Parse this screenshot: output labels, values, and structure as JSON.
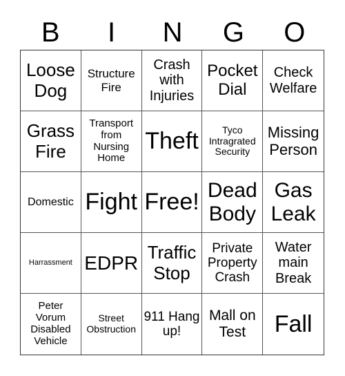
{
  "header": {
    "letters": [
      "B",
      "I",
      "N",
      "G",
      "O"
    ]
  },
  "cells": [
    "Loose Dog",
    "Structure Fire",
    "Crash with Injuries",
    "Pocket Dial",
    "Check Welfare",
    "Grass Fire",
    "Transport from Nursing Home",
    "Theft",
    "Tyco Intragrated Security",
    "Missing Person",
    "Domestic",
    "Fight",
    "Free!",
    "Dead Body",
    "Gas Leak",
    "Harrassment",
    "EDPR",
    "Traffic Stop",
    "Private Property Crash",
    "Water main Break",
    "Peter Vorum Disabled Vehicle",
    "Street Obstruction",
    "911 Hang up!",
    "Mall on Test",
    "Fall"
  ],
  "free_space_label": "Free!"
}
